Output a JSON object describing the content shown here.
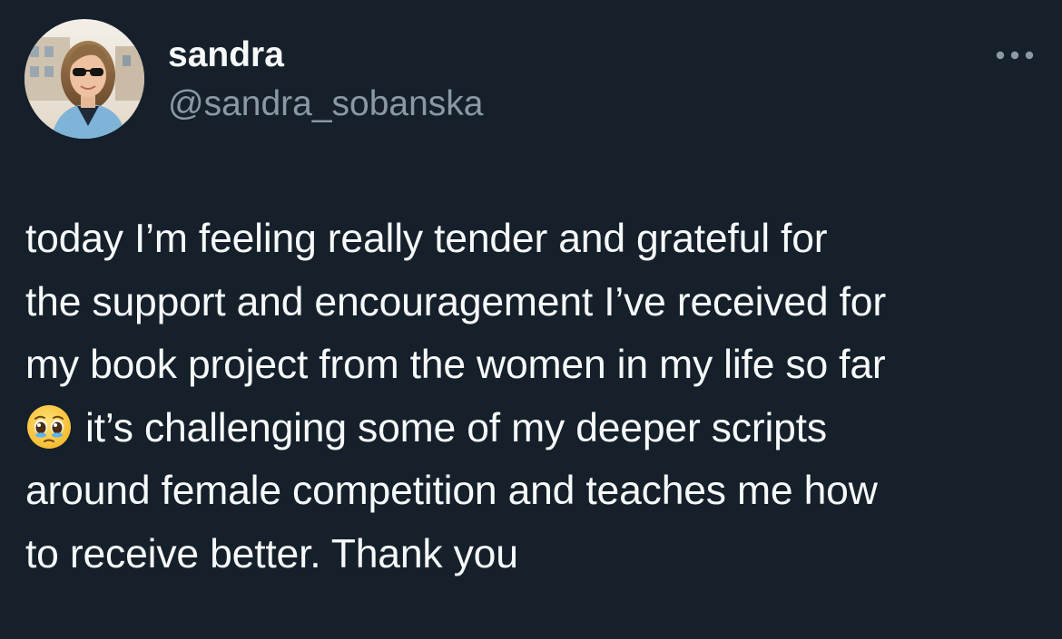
{
  "author": {
    "display_name": "sandra",
    "handle": "@sandra_sobanska"
  },
  "more_button": {
    "icon": "more-horizontal-icon"
  },
  "tweet": {
    "lines": [
      "today I’m feeling really tender and grateful for",
      "the support and encouragement I’ve received for",
      "my book project from the women in my life so far",
      "it’s challenging some of my deeper scripts",
      "around female competition and teaches me how",
      "to receive better. Thank you"
    ],
    "emoji": "pleading-face-with-tears-icon"
  },
  "colors": {
    "background": "#15202b",
    "primary_text": "#f7f9f9",
    "secondary_text": "#8b98a5"
  }
}
